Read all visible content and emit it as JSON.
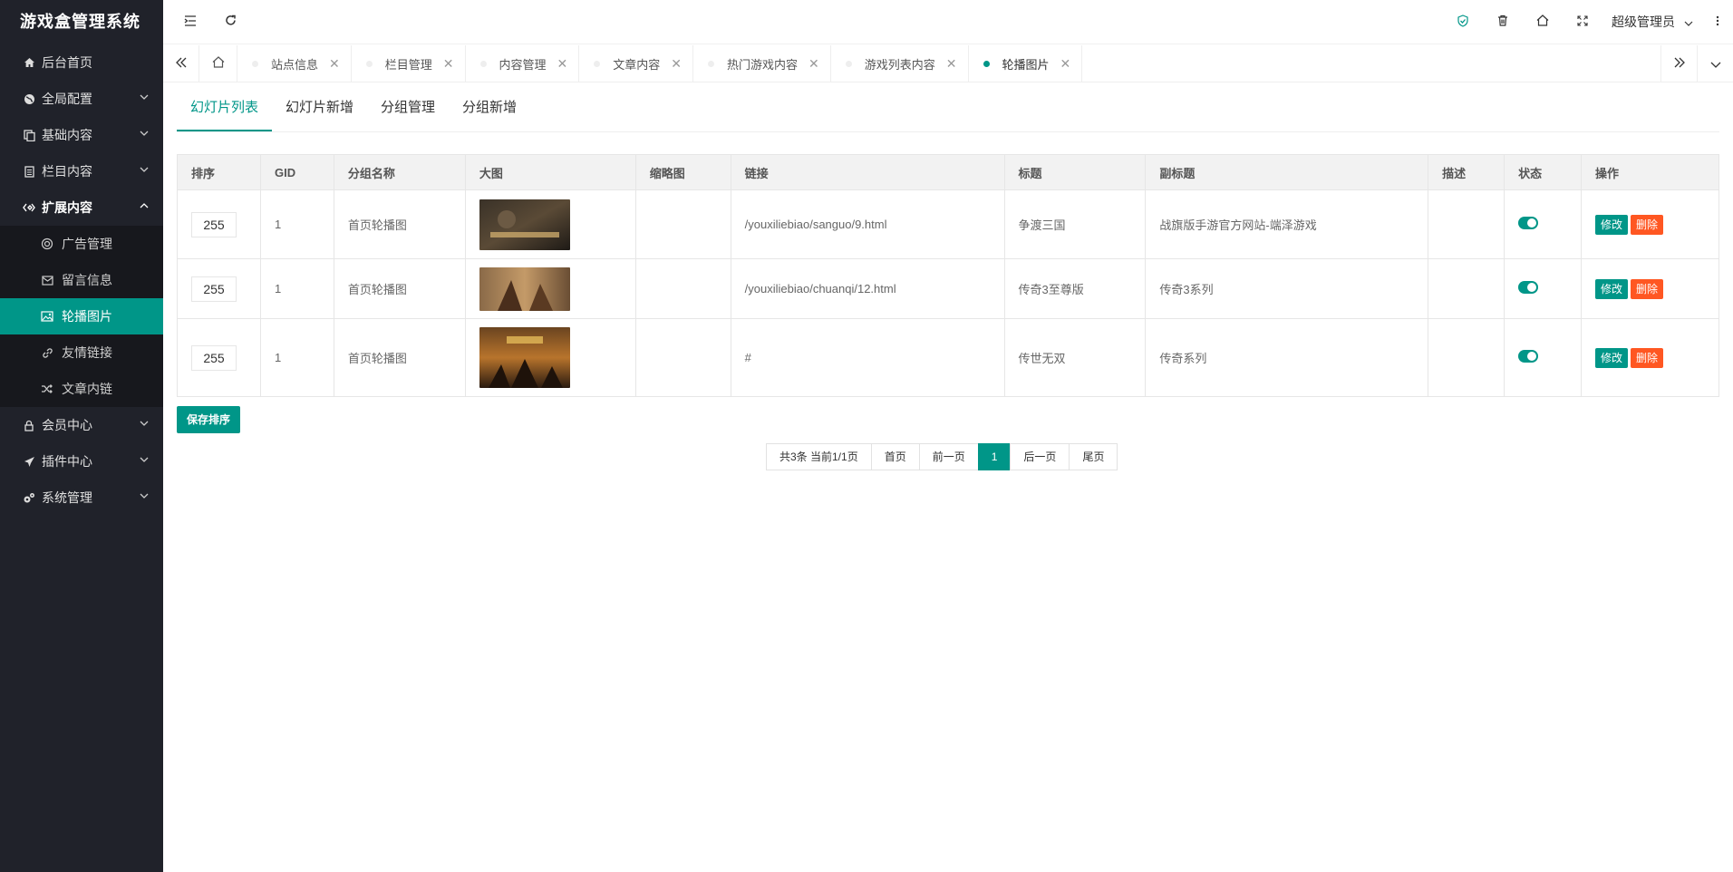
{
  "app": {
    "title": "游戏盒管理系统"
  },
  "sidebar": {
    "items": [
      {
        "label": "后台首页",
        "icon": "home-icon",
        "chevron": false
      },
      {
        "label": "全局配置",
        "icon": "globe-icon",
        "chevron": true
      },
      {
        "label": "基础内容",
        "icon": "copy-icon",
        "chevron": true
      },
      {
        "label": "栏目内容",
        "icon": "file-icon",
        "chevron": true
      },
      {
        "label": "扩展内容",
        "icon": "code-icon",
        "chevron": true,
        "open": true
      }
    ],
    "sub_items": [
      {
        "label": "广告管理",
        "icon": "ad-icon"
      },
      {
        "label": "留言信息",
        "icon": "envelope-icon"
      },
      {
        "label": "轮播图片",
        "icon": "image-icon",
        "active": true
      },
      {
        "label": "友情链接",
        "icon": "link-icon"
      },
      {
        "label": "文章内链",
        "icon": "shuffle-icon"
      }
    ],
    "items_after": [
      {
        "label": "会员中心",
        "icon": "user-icon",
        "chevron": true
      },
      {
        "label": "插件中心",
        "icon": "plane-icon",
        "chevron": true
      },
      {
        "label": "系统管理",
        "icon": "cogs-icon",
        "chevron": true
      }
    ]
  },
  "header": {
    "user": "超级管理员"
  },
  "tabs": [
    {
      "label": "站点信息"
    },
    {
      "label": "栏目管理"
    },
    {
      "label": "内容管理"
    },
    {
      "label": "文章内容"
    },
    {
      "label": "热门游戏内容"
    },
    {
      "label": "游戏列表内容"
    },
    {
      "label": "轮播图片",
      "active": true
    }
  ],
  "subtabs": [
    "幻灯片列表",
    "幻灯片新增",
    "分组管理",
    "分组新增"
  ],
  "table": {
    "headers": [
      "排序",
      "GID",
      "分组名称",
      "大图",
      "缩略图",
      "链接",
      "标题",
      "副标题",
      "描述",
      "状态",
      "操作"
    ],
    "rows": [
      {
        "sort": "255",
        "gid": "1",
        "group": "首页轮播图",
        "link": "/youxiliebiao/sanguo/9.html",
        "title": "争渡三国",
        "subtitle": "战旗版手游官方网站-端泽游戏",
        "desc": ""
      },
      {
        "sort": "255",
        "gid": "1",
        "group": "首页轮播图",
        "link": "/youxiliebiao/chuanqi/12.html",
        "title": "传奇3至尊版",
        "subtitle": "传奇3系列",
        "desc": ""
      },
      {
        "sort": "255",
        "gid": "1",
        "group": "首页轮播图",
        "link": "#",
        "title": "传世无双",
        "subtitle": "传奇系列",
        "desc": ""
      }
    ],
    "edit_label": "修改",
    "delete_label": "删除"
  },
  "save_label": "保存排序",
  "pager": {
    "info": "共3条 当前1/1页",
    "first": "首页",
    "prev": "前一页",
    "current": "1",
    "next": "后一页",
    "last": "尾页"
  }
}
